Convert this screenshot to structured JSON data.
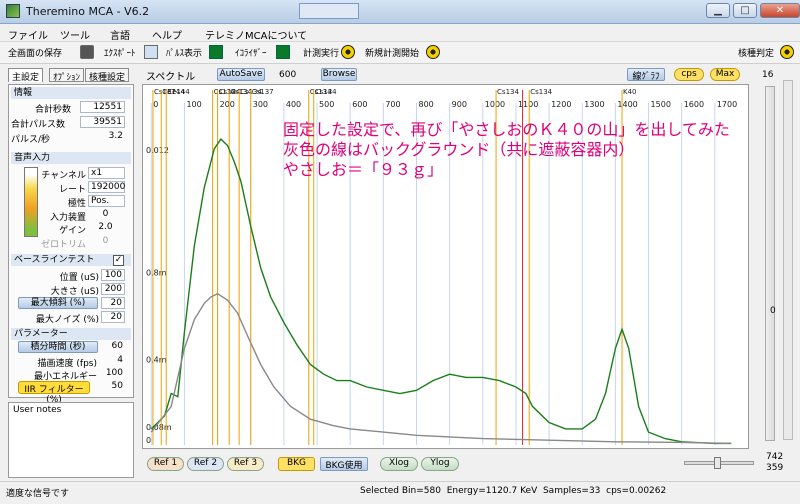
{
  "window": {
    "title": "Theremino MCA - V6.2",
    "min_label": "▁",
    "max_label": "□",
    "close_label": "✕"
  },
  "menu": [
    "ファイル",
    "ツール",
    "言語",
    "ヘルプ",
    "テレミノMCAについて"
  ],
  "toolbar": {
    "save_all": "全画面の保存",
    "export": "ｴｸｽﾎﾟｰﾄ",
    "pulse_display": "ﾊﾟﾙｽ表示",
    "equalizer": "ｲｺﾗｲｻﾞｰ",
    "run_measure": "計測実行",
    "new_measure": "新規計測開始",
    "nuclide": "核種判定"
  },
  "tabs": {
    "main": "主設定",
    "options": "ｵﾌﾟｼｮﾝ",
    "nuclide": "核種設定"
  },
  "spectrum_bar": {
    "label": "スペクトル",
    "autosave": "AutoSave",
    "autosave_value": "600",
    "browse": "Browse",
    "line_graph": "線ｸﾞﾗﾌ",
    "cps": "cps",
    "max": "Max"
  },
  "info": {
    "header": "情報",
    "rows": [
      {
        "label": "合計秒数",
        "value": "12551"
      },
      {
        "label": "合計パルス数",
        "value": "39551"
      },
      {
        "label": "パルス/秒",
        "value": "3.2"
      }
    ]
  },
  "audio": {
    "header": "音声入力",
    "rows": [
      {
        "label": "チャンネル",
        "value": "x1"
      },
      {
        "label": "レート",
        "value": "192000"
      },
      {
        "label": "極性",
        "value": "Pos."
      },
      {
        "label": "入力装置",
        "value": "0"
      },
      {
        "label": "ゲイン",
        "value": "2.0"
      },
      {
        "label": "ゼロトリム",
        "value": "0"
      }
    ]
  },
  "baseline": {
    "header": "ベースラインテスト",
    "check": "✓",
    "rows": [
      {
        "label": "位置 (uS)",
        "value": "100"
      },
      {
        "label": "大きさ (uS)",
        "value": "200"
      },
      {
        "label": "最大傾斜 (%)",
        "value": "20"
      },
      {
        "label": "最大ノイズ (%)",
        "value": "20"
      }
    ]
  },
  "params": {
    "header": "パラメーター",
    "rows": [
      {
        "label": "積分時間 (秒)",
        "value": "60"
      },
      {
        "label": "描画速度 (fps)",
        "value": "4"
      },
      {
        "label": "最小エネルギー",
        "value": "100"
      },
      {
        "label": "IIR フィルター (%)",
        "value": "50"
      }
    ]
  },
  "user_notes": {
    "header": "User notes"
  },
  "chart_data": {
    "type": "line",
    "x_ticks": [
      "0",
      "100",
      "200",
      "300",
      "400",
      "500",
      "600",
      "700",
      "800",
      "900",
      "1000",
      "1100",
      "1200",
      "1300",
      "1400",
      "1500",
      "1600",
      "1700"
    ],
    "y_ticks": [
      "0.012",
      "0.8m",
      "0.4m",
      "0.08m",
      "0"
    ],
    "nuclide_labels": [
      "Cs137",
      "Ce144",
      "Ce144",
      "Cs134",
      "Cs134",
      "Cs134",
      "Cs134",
      "Cs137",
      "Cs134",
      "Cs134",
      "Cs134",
      "Cs134",
      "K40"
    ],
    "annotation": [
      "固定した設定で、再び「やさしおのＫ４０の山」を出してみた",
      "灰色の線はバックグラウンド（共に遮蔽容器内）",
      "やさしお＝「９３ｇ」"
    ],
    "xlim": [
      -25,
      1800
    ],
    "series": [
      {
        "color": "#1a7f1a",
        "values": [
          [
            0,
            0.05
          ],
          [
            40,
            0.09
          ],
          [
            60,
            0.16
          ],
          [
            80,
            0.15
          ],
          [
            100,
            0.35
          ],
          [
            130,
            0.62
          ],
          [
            160,
            0.8
          ],
          [
            190,
            0.92
          ],
          [
            210,
            0.95
          ],
          [
            230,
            0.93
          ],
          [
            250,
            0.88
          ],
          [
            270,
            0.82
          ],
          [
            300,
            0.68
          ],
          [
            330,
            0.55
          ],
          [
            360,
            0.46
          ],
          [
            400,
            0.38
          ],
          [
            440,
            0.31
          ],
          [
            480,
            0.25
          ],
          [
            520,
            0.22
          ],
          [
            560,
            0.2
          ],
          [
            600,
            0.2
          ],
          [
            650,
            0.18
          ],
          [
            700,
            0.17
          ],
          [
            750,
            0.16
          ],
          [
            800,
            0.17
          ],
          [
            850,
            0.2
          ],
          [
            900,
            0.22
          ],
          [
            950,
            0.21
          ],
          [
            1000,
            0.21
          ],
          [
            1050,
            0.2
          ],
          [
            1100,
            0.18
          ],
          [
            1130,
            0.16
          ],
          [
            1150,
            0.12
          ],
          [
            1200,
            0.07
          ],
          [
            1250,
            0.05
          ],
          [
            1300,
            0.05
          ],
          [
            1340,
            0.08
          ],
          [
            1370,
            0.16
          ],
          [
            1400,
            0.3
          ],
          [
            1420,
            0.36
          ],
          [
            1440,
            0.3
          ],
          [
            1470,
            0.12
          ],
          [
            1500,
            0.04
          ],
          [
            1550,
            0.02
          ],
          [
            1600,
            0.01
          ],
          [
            1700,
            0.005
          ],
          [
            1750,
            0.005
          ]
        ]
      },
      {
        "color": "#888888",
        "values": [
          [
            0,
            0.04
          ],
          [
            60,
            0.12
          ],
          [
            100,
            0.3
          ],
          [
            130,
            0.39
          ],
          [
            160,
            0.44
          ],
          [
            180,
            0.46
          ],
          [
            200,
            0.47
          ],
          [
            230,
            0.45
          ],
          [
            260,
            0.41
          ],
          [
            290,
            0.34
          ],
          [
            330,
            0.25
          ],
          [
            370,
            0.18
          ],
          [
            420,
            0.12
          ],
          [
            480,
            0.08
          ],
          [
            550,
            0.06
          ],
          [
            600,
            0.05
          ],
          [
            700,
            0.04
          ],
          [
            800,
            0.03
          ],
          [
            900,
            0.025
          ],
          [
            1000,
            0.02
          ],
          [
            1200,
            0.015
          ],
          [
            1400,
            0.01
          ],
          [
            1600,
            0.008
          ],
          [
            1750,
            0.005
          ]
        ]
      }
    ]
  },
  "right": {
    "top_value": "16",
    "mid_value": "0",
    "v1": "742",
    "v2": "359"
  },
  "bottom_buttons": {
    "ref1": "Ref 1",
    "ref2": "Ref 2",
    "ref3": "Ref 3",
    "bkg": "BKG",
    "bkg_use": "BKG使用",
    "xlog": "Xlog",
    "ylog": "Ylog"
  },
  "status": {
    "left": "適度な信号です",
    "selected": "Selected Bin=580  Energy=1120.7 KeV  Samples=33  cps=0.00262"
  }
}
